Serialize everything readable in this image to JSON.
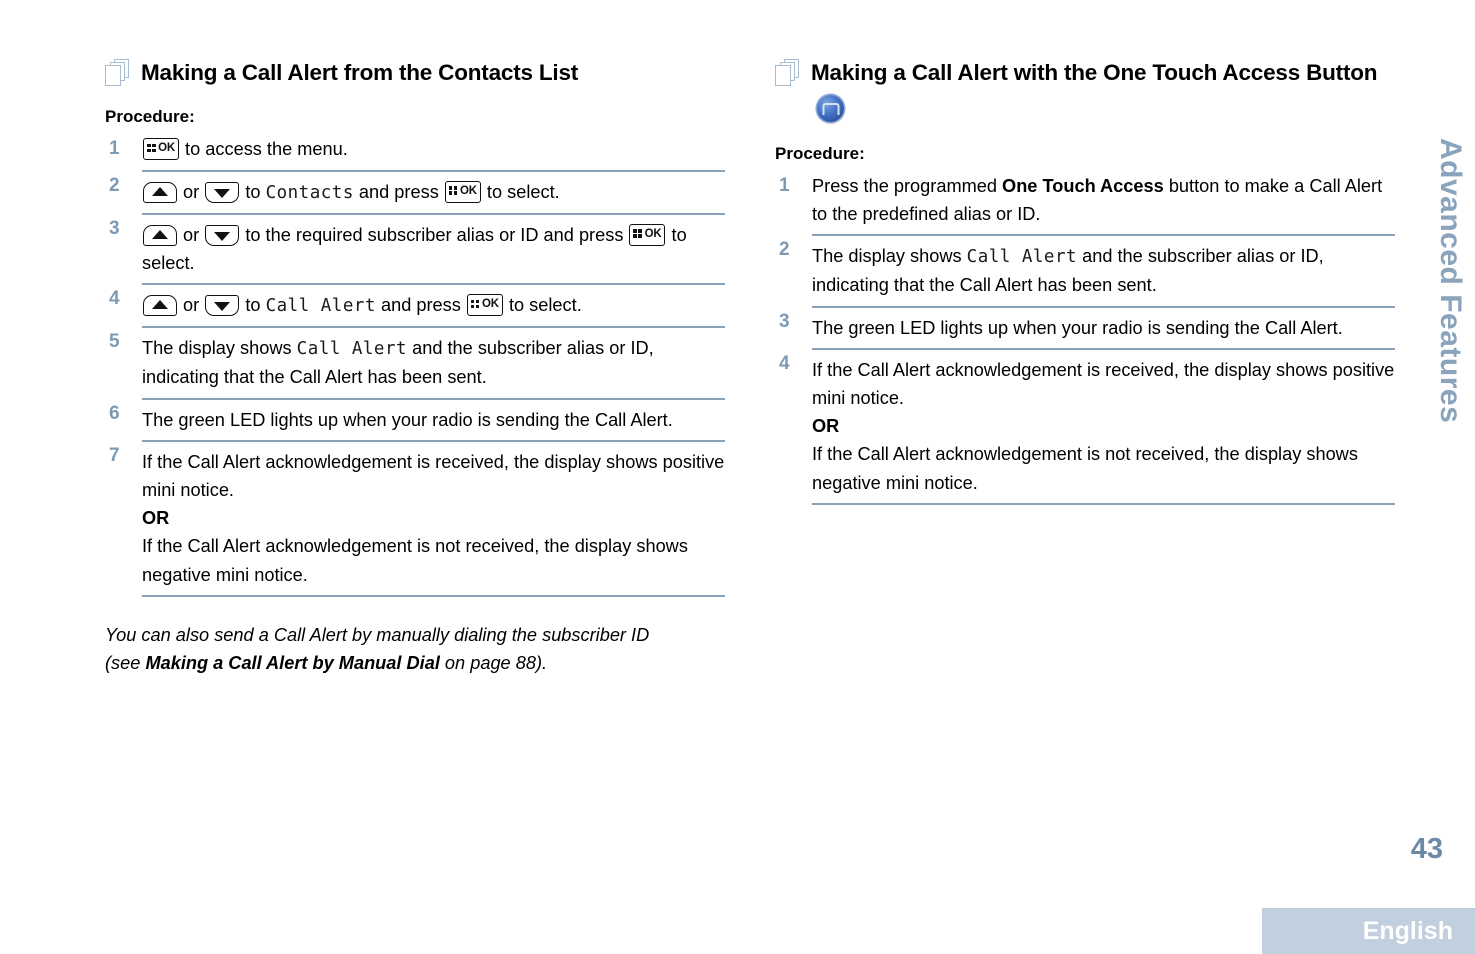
{
  "sidebar": {
    "chapter_label": "Advanced Features"
  },
  "footer": {
    "page_number": "43",
    "language": "English"
  },
  "icons": {
    "section": "stacked-pages-icon",
    "menu_ok": "menu-ok-key-icon",
    "arrow_up": "up-arrow-key-icon",
    "arrow_down": "down-arrow-key-icon",
    "one_touch": "one-touch-access-button-icon"
  },
  "colors": {
    "accent_blue_gray": "#8ba4bd",
    "step_number": "#7d9ab5",
    "rule": "#8ba2b8",
    "page_number": "#6e89a5",
    "lang_bar": "#c1cfdf",
    "page_icon_outline": "#a9bdd2"
  },
  "left_column": {
    "heading": "Making a Call Alert from the Contacts List",
    "procedure_label": "Procedure:",
    "steps": [
      {
        "num": "1",
        "parts": [
          {
            "type": "key-ok"
          },
          {
            "type": "text",
            "value": " to access the menu."
          }
        ]
      },
      {
        "num": "2",
        "parts": [
          {
            "type": "key-up"
          },
          {
            "type": "text",
            "value": " or "
          },
          {
            "type": "key-down"
          },
          {
            "type": "text",
            "value": " to "
          },
          {
            "type": "lcd",
            "value": "Contacts"
          },
          {
            "type": "text",
            "value": " and press "
          },
          {
            "type": "key-ok"
          },
          {
            "type": "text",
            "value": " to select."
          }
        ]
      },
      {
        "num": "3",
        "parts": [
          {
            "type": "key-up"
          },
          {
            "type": "text",
            "value": " or "
          },
          {
            "type": "key-down"
          },
          {
            "type": "text",
            "value": " to the required subscriber alias or ID and press "
          },
          {
            "type": "key-ok"
          },
          {
            "type": "text",
            "value": " to select."
          }
        ]
      },
      {
        "num": "4",
        "parts": [
          {
            "type": "key-up"
          },
          {
            "type": "text",
            "value": " or "
          },
          {
            "type": "key-down"
          },
          {
            "type": "text",
            "value": " to "
          },
          {
            "type": "lcd",
            "value": "Call Alert"
          },
          {
            "type": "text",
            "value": " and press "
          },
          {
            "type": "key-ok"
          },
          {
            "type": "text",
            "value": " to select."
          }
        ]
      },
      {
        "num": "5",
        "parts": [
          {
            "type": "text",
            "value": "The display shows "
          },
          {
            "type": "lcd",
            "value": "Call Alert"
          },
          {
            "type": "text",
            "value": " and the subscriber alias or ID, indicating that the Call Alert has been sent."
          }
        ]
      },
      {
        "num": "6",
        "parts": [
          {
            "type": "text",
            "value": "The green LED lights up when your radio is sending the Call Alert."
          }
        ]
      },
      {
        "num": "7",
        "parts": [
          {
            "type": "text",
            "value": "If the Call Alert acknowledgement is received, the display shows positive mini notice."
          },
          {
            "type": "or"
          },
          {
            "type": "text",
            "value": "If the Call Alert acknowledgement is not received, the display shows negative mini notice."
          }
        ]
      }
    ],
    "note": {
      "lead": "You can also send a Call Alert by manually dialing the subscriber ID (see ",
      "bold": "Making a Call Alert by Manual Dial",
      "tail": " on page 88)."
    }
  },
  "right_column": {
    "heading": "Making a Call Alert with the One Touch Access Button",
    "procedure_label": "Procedure:",
    "steps": [
      {
        "num": "1",
        "parts": [
          {
            "type": "text",
            "value": "Press the programmed "
          },
          {
            "type": "bold",
            "value": "One Touch Access"
          },
          {
            "type": "text",
            "value": " button to make a Call Alert to the predefined alias or ID."
          }
        ]
      },
      {
        "num": "2",
        "parts": [
          {
            "type": "text",
            "value": "The display shows "
          },
          {
            "type": "lcd",
            "value": "Call Alert"
          },
          {
            "type": "text",
            "value": " and the subscriber alias or ID, indicating that the Call Alert has been sent."
          }
        ]
      },
      {
        "num": "3",
        "parts": [
          {
            "type": "text",
            "value": "The green LED lights up when your radio is sending the Call Alert."
          }
        ]
      },
      {
        "num": "4",
        "parts": [
          {
            "type": "text",
            "value": "If the Call Alert acknowledgement is received, the display shows positive mini notice."
          },
          {
            "type": "or"
          },
          {
            "type": "text",
            "value": "If the Call Alert acknowledgement is not received, the display shows negative mini notice."
          }
        ]
      }
    ],
    "or_label": "OR"
  }
}
